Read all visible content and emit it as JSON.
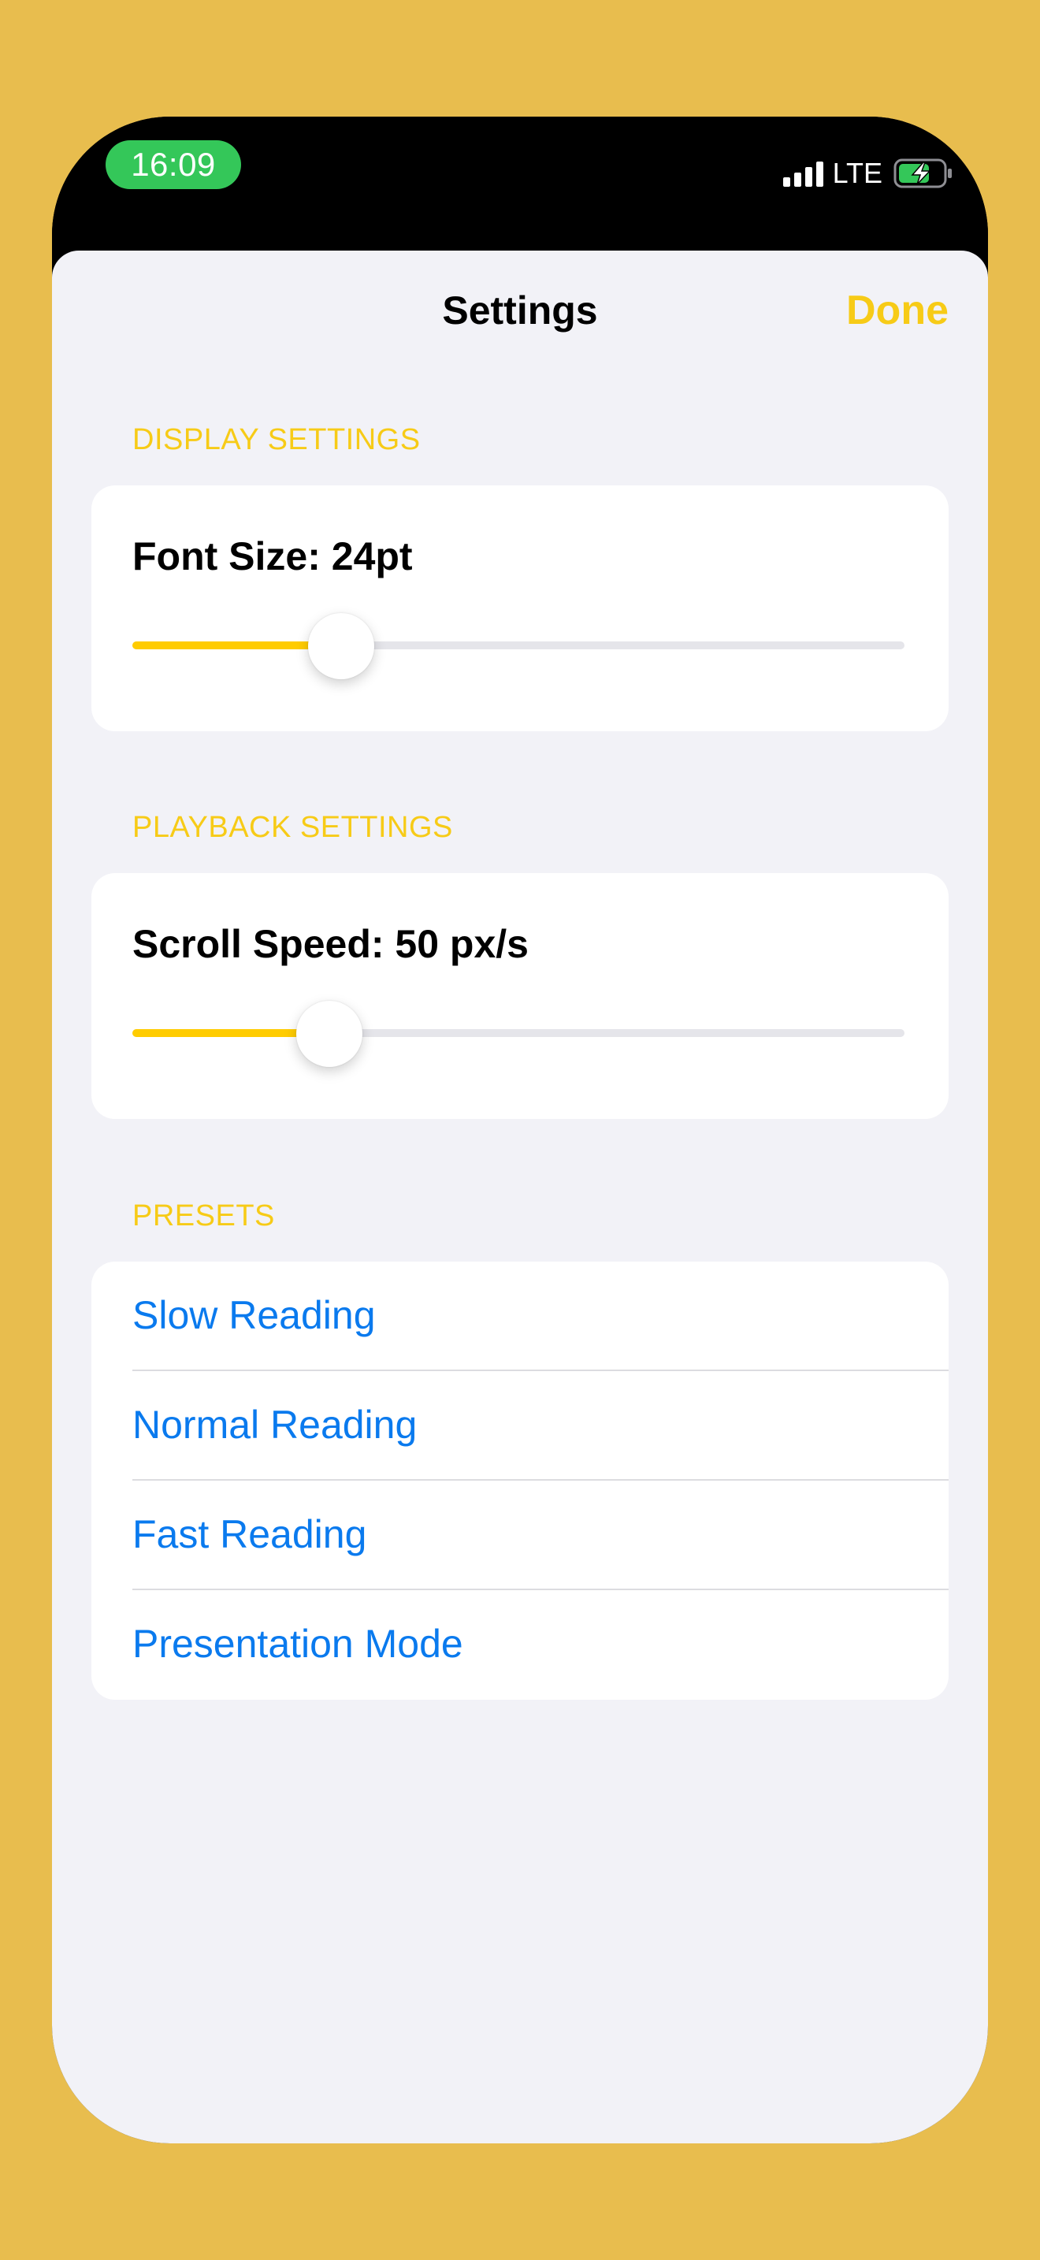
{
  "status_bar": {
    "time": "16:09",
    "network": "LTE",
    "time_pill_color": "#34C759",
    "signal_icon": "cellular-signal-icon",
    "battery_icon": "battery-charging-icon"
  },
  "sheet": {
    "title": "Settings",
    "done_label": "Done"
  },
  "colors": {
    "accent": "#F7CB17",
    "link": "#0A7AEE",
    "background": "#E8BD4E",
    "sheet_background": "#F2F2F7"
  },
  "display_settings": {
    "header": "DISPLAY SETTINGS",
    "font_size_label": "Font Size: 24pt",
    "font_size_slider_fraction": 0.27
  },
  "playback_settings": {
    "header": "PLAYBACK SETTINGS",
    "scroll_speed_label": "Scroll Speed: 50 px/s",
    "scroll_speed_slider_fraction": 0.255
  },
  "presets": {
    "header": "PRESETS",
    "items": [
      {
        "label": "Slow Reading"
      },
      {
        "label": "Normal Reading"
      },
      {
        "label": "Fast Reading"
      },
      {
        "label": "Presentation Mode"
      }
    ]
  }
}
